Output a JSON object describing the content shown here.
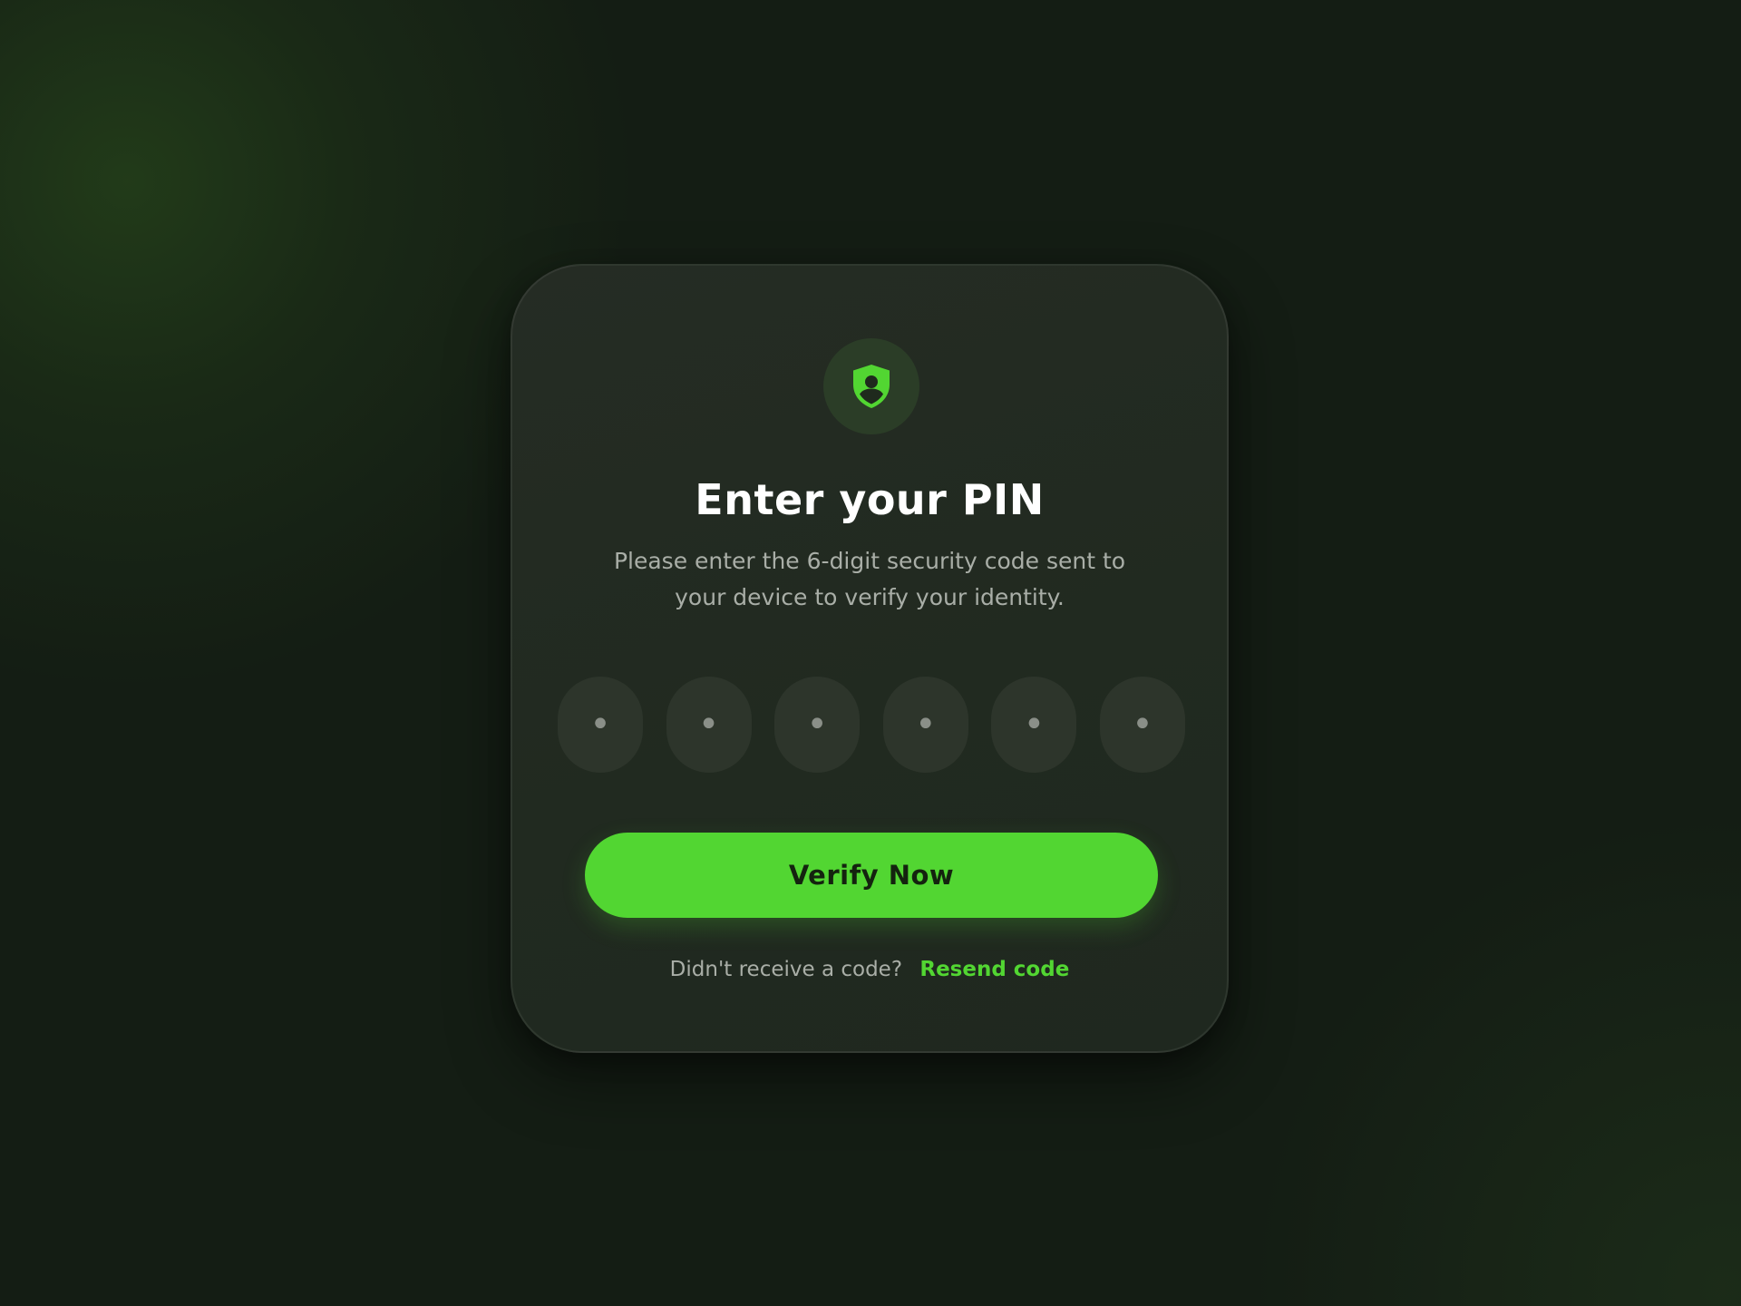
{
  "colors": {
    "accent": "#52d632",
    "background": "#141d14",
    "card": "#222a21",
    "pin_box": "#2d352b",
    "text_primary": "#ffffff",
    "text_secondary": "#a9aea7"
  },
  "card": {
    "icon": "shield-user-icon",
    "title": "Enter your PIN",
    "subtitle": "Please enter the 6-digit security code sent to your device to verify your identity.",
    "pin": {
      "length": 6,
      "placeholder_glyph": "•",
      "digits": [
        "•",
        "•",
        "•",
        "•",
        "•",
        "•"
      ]
    },
    "verify_label": "Verify Now",
    "resend_prompt": "Didn't receive a code?",
    "resend_label": "Resend code"
  }
}
